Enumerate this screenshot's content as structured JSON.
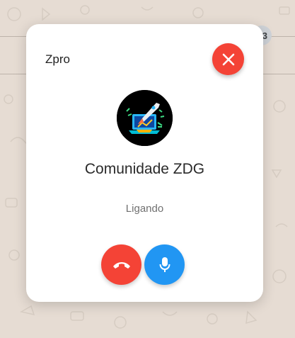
{
  "dialog": {
    "app_name": "Zpro",
    "contact_name": "Comunidade ZDG",
    "status": "Ligando",
    "avatar_icon": "rocket-laptop-icon"
  },
  "background": {
    "partial_badge_text": "3"
  },
  "buttons": {
    "close_icon": "close-icon",
    "hangup_icon": "phone-hangup-icon",
    "mic_icon": "microphone-icon"
  },
  "colors": {
    "danger": "#f44336",
    "primary": "#2196f3",
    "wallpaper": "#e6dcd3"
  }
}
